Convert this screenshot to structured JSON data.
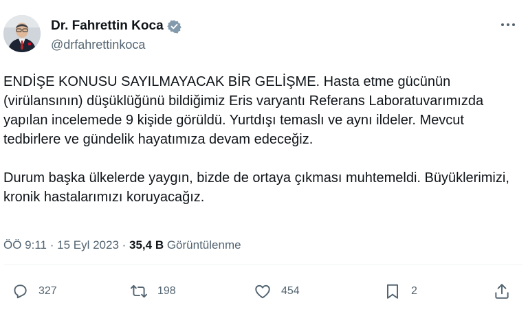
{
  "author": {
    "name": "Dr. Fahrettin Koca",
    "handle": "@drfahrettinkoca",
    "verified_color": "#829aab"
  },
  "tweet": {
    "paragraph_1": "ENDİŞE KONUSU SAYILMAYACAK BİR GELİŞME. Hasta etme gücünün (virülansının) düşüklüğünü bildiğimiz Eris varyantı Referans Laboratuvarımızda yapılan incelemede 9 kişide görüldü. Yurtdışı temaslı ve aynı ildeler. Mevcut tedbirlere ve gündelik hayatımıza devam edeceğiz.",
    "paragraph_2": "Durum başka ülkelerde yaygın, bizde de ortaya çıkması muhtemeldi. Büyüklerimizi, kronik hastalarımızı koruyacağız."
  },
  "meta": {
    "time": "ÖÖ 9:11",
    "separator_1": " · ",
    "date": "15 Eyl 2023",
    "separator_2": " · ",
    "views_count": "35,4 B",
    "views_label": " Görüntülenme"
  },
  "actions": {
    "replies": "327",
    "retweets": "198",
    "likes": "454",
    "bookmarks": "2"
  },
  "icons": {
    "avatar": "profile-photo",
    "verified": "verified-badge-icon",
    "more": "more-dots-icon",
    "reply": "reply-icon",
    "retweet": "retweet-icon",
    "like": "heart-icon",
    "bookmark": "bookmark-icon",
    "share": "share-icon"
  },
  "colors": {
    "text_primary": "#0f1419",
    "text_secondary": "#536471",
    "divider": "#eff3f4"
  }
}
